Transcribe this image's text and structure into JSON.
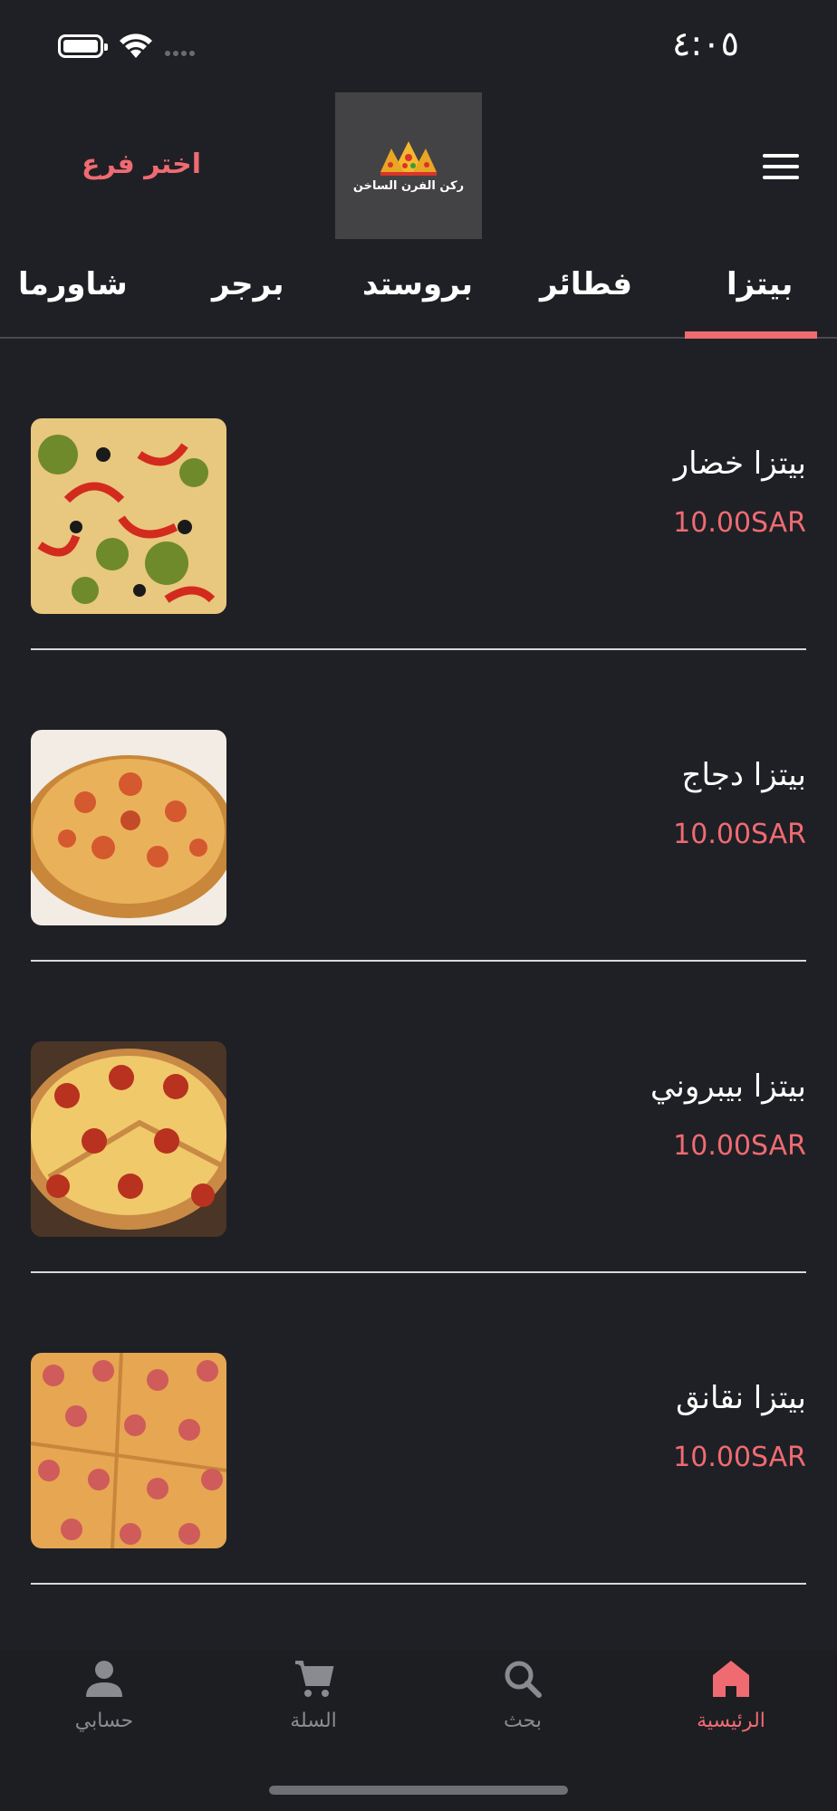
{
  "status_bar": {
    "time": "٤:٠٥"
  },
  "header": {
    "branch_button": "اختر فرع",
    "logo_text": "ركن الفرن الساخن"
  },
  "tabs": [
    {
      "label": "بيتزا",
      "active": true
    },
    {
      "label": "فطائر",
      "active": false
    },
    {
      "label": "بروستد",
      "active": false
    },
    {
      "label": "برجر",
      "active": false
    },
    {
      "label": "شاورما",
      "active": false
    }
  ],
  "products": [
    {
      "name": "بيتزا خضار",
      "price": "10.00SAR"
    },
    {
      "name": "بيتزا دجاج",
      "price": "10.00SAR"
    },
    {
      "name": "بيتزا بيبروني",
      "price": "10.00SAR"
    },
    {
      "name": "بيتزا نقانق",
      "price": "10.00SAR"
    }
  ],
  "bottom_nav": [
    {
      "label": "الرئيسية",
      "icon": "home-icon",
      "active": true
    },
    {
      "label": "بحث",
      "icon": "search-icon",
      "active": false
    },
    {
      "label": "السلة",
      "icon": "cart-icon",
      "active": false
    },
    {
      "label": "حسابي",
      "icon": "user-icon",
      "active": false
    }
  ],
  "colors": {
    "accent": "#ef6b72",
    "background": "#1f2025",
    "inactive": "#8a8b90"
  }
}
